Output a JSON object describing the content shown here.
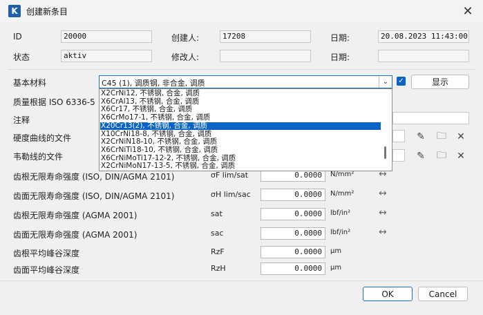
{
  "window": {
    "title": "创建新条目",
    "app_icon": "K"
  },
  "header": {
    "id_label": "ID",
    "id_value": "20000",
    "creator_label": "创建人:",
    "creator_value": "17208",
    "date_label": "日期:",
    "date_value": "20.08.2023 11:43:00",
    "status_label": "状态",
    "status_value": "aktiv",
    "modifier_label": "修改人:",
    "modifier_value": "",
    "mod_date_label": "日期:",
    "mod_date_value": ""
  },
  "form": {
    "base_material_label": "基本材料",
    "base_material_value": "C45 (1), 调质钢, 非合金, 调质",
    "show_checked": true,
    "show_button": "显示",
    "quality_label": "质量根据 ISO 6336-5",
    "note_label": "注释",
    "hardness_file_label": "硬度曲线的文件",
    "woehler_file_label": "韦勒线的文件"
  },
  "dropdown": {
    "items": [
      "X2CrNi12, 不锈钢, 合金, 调质",
      "X6CrAl13, 不锈钢, 合金, 调质",
      "X6Cr17, 不锈钢, 合金, 调质",
      "X6CrMo17-1, 不锈钢, 合金, 调质",
      "X20Cr13(2), 不锈钢, 合金, 调质",
      "X10CrNi18-8, 不锈钢, 合金, 调质",
      "X2CrNiN18-10, 不锈钢, 合金, 调质",
      "X6CrNiTi18-10, 不锈钢, 合金, 调质",
      "X6CrNiMoTi17-12-2, 不锈钢, 合金, 调质",
      "X2CrNiMoN17-13-5, 不锈钢, 合金, 调质"
    ],
    "selected_index": 4
  },
  "strength_rows": [
    {
      "label": "齿根无限寿命强度 (ISO, DIN/AGMA 2101)",
      "symbol": "σF lim/sat",
      "value": "0.0000",
      "unit": "N/mm²",
      "has_arrow": true
    },
    {
      "label": "齿面无限寿命强度 (ISO, DIN/AGMA 2101)",
      "symbol": "σH lim/sac",
      "value": "0.0000",
      "unit": "N/mm²",
      "has_arrow": true
    },
    {
      "label": "齿根无限寿命强度 (AGMA 2001)",
      "symbol": "sat",
      "value": "0.0000",
      "unit": "lbf/in²",
      "has_arrow": true
    },
    {
      "label": "齿面无限寿命强度 (AGMA 2001)",
      "symbol": "sac",
      "value": "0.0000",
      "unit": "lbf/in²",
      "has_arrow": true
    },
    {
      "label": "齿根平均峰谷深度",
      "symbol": "RzF",
      "value": "0.0000",
      "unit": "μm",
      "has_arrow": false
    },
    {
      "label": "齿面平均峰谷深度",
      "symbol": "RzH",
      "value": "0.0000",
      "unit": "μm",
      "has_arrow": false
    }
  ],
  "buttons": {
    "ok": "OK",
    "cancel": "Cancel"
  },
  "icons": {
    "edit": "pencil-icon",
    "folder": "folder-icon",
    "clear": "close-icon",
    "arrows": "left-right-arrow-icon"
  }
}
